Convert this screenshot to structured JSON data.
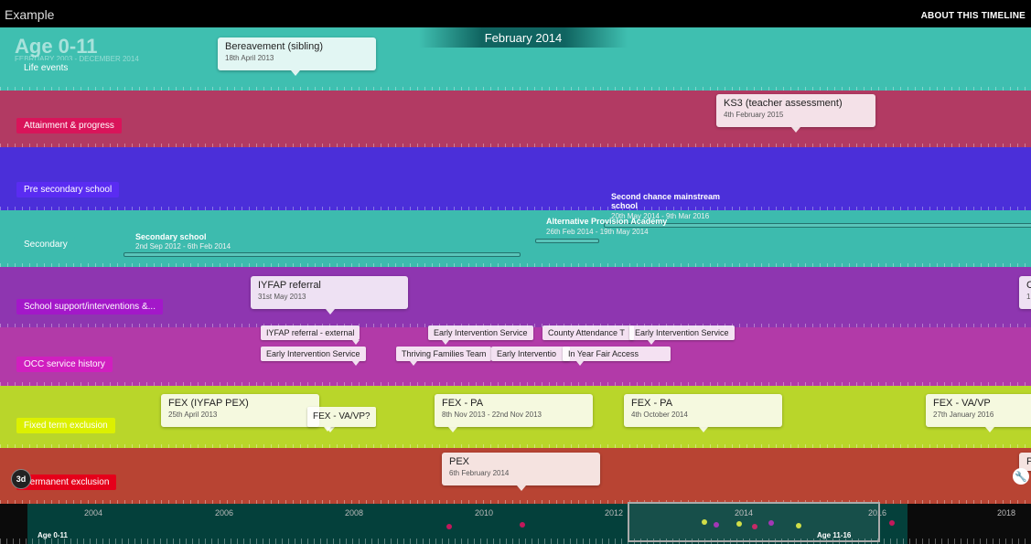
{
  "app": {
    "title": "Example",
    "about": "ABOUT THIS TIMELINE"
  },
  "era": {
    "name": "Age 0-11",
    "range": "FEBRUARY 2003 - DECEMBER 2014"
  },
  "current_month": "February 2014",
  "colors": {
    "life": "#3fbfb0",
    "attainment": "#b23a63",
    "pre_secondary": "#4b2fd9",
    "secondary": "#3dbbae",
    "support": "#8e36b0",
    "occ": "#b23aa8",
    "fixed": "#b9d62a",
    "permanent": "#b84433"
  },
  "bands": {
    "life": {
      "label": "Life events"
    },
    "attainment": {
      "label": "Attainment & progress"
    },
    "pre_secondary": {
      "label": "Pre secondary school"
    },
    "secondary": {
      "label": "Secondary"
    },
    "support": {
      "label": "School support/interventions &..."
    },
    "occ": {
      "label": "OCC service history"
    },
    "fixed": {
      "label": "Fixed term exclusion"
    },
    "permanent": {
      "label": "Permanent exclusion"
    }
  },
  "events": {
    "bereavement": {
      "title": "Bereavement (sibling)",
      "date": "18th April 2013"
    },
    "ks3": {
      "title": "KS3 (teacher assessment)",
      "date": "4th February 2015"
    },
    "secondary_school": {
      "title": "Secondary school",
      "date": "2nd Sep 2012 - 6th Feb 2014"
    },
    "second_chance": {
      "title": "Second chance mainstream school",
      "date": "20th May 2014 - 9th Mar 2016"
    },
    "alt_provision": {
      "title": "Alternative Provision Academy",
      "date": "26th Feb 2014 - 19th May 2014"
    },
    "iyfap": {
      "title": "IYFAP referral",
      "date": "31st May 2013"
    },
    "support_right": {
      "title": "C",
      "date": "1"
    },
    "fex1": {
      "title": "FEX (IYFAP PEX)",
      "date": "25th April 2013"
    },
    "fex_vavp": {
      "title": "FEX - VA/VP?"
    },
    "fex_pa1": {
      "title": "FEX - PA",
      "date": "8th Nov 2013 - 22nd Nov 2013"
    },
    "fex_pa2": {
      "title": "FEX - PA",
      "date": "4th October 2014"
    },
    "fex_vavp2": {
      "title": "FEX - VA/VP",
      "date": "27th January 2016"
    },
    "pex": {
      "title": "PEX",
      "date": "6th February 2014"
    },
    "pex_right": {
      "title": "P"
    }
  },
  "occ_items": [
    "IYFAP referral - external",
    "Early Intervention Service",
    "Early Intervention Service",
    "County Attendance T",
    "Early Intervention Service",
    "Thriving Families Team",
    "Early Interventio",
    "In Year Fair Access"
  ],
  "controls": {
    "mode_3d": "3d",
    "settings_icon": "wrench-icon"
  },
  "navigator": {
    "years": [
      "2004",
      "2006",
      "2008",
      "2010",
      "2012",
      "2014",
      "2016",
      "2018"
    ],
    "era_left": "Age 0-11",
    "era_right": "Age 11-16"
  }
}
